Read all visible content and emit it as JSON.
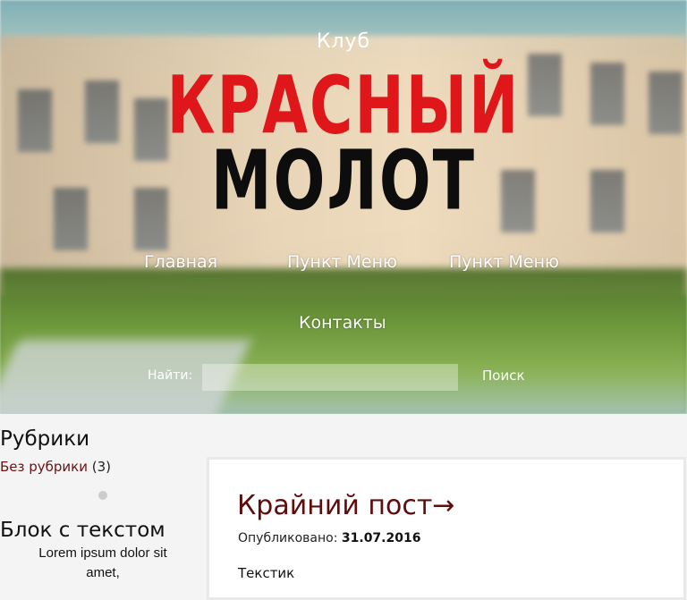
{
  "header": {
    "club": "Клуб",
    "logo_line1": "КРАСНЫЙ",
    "logo_line2": "МОЛОТ"
  },
  "nav": {
    "items": [
      "Главная",
      "Пункт Меню",
      "Пункт Меню",
      "Контакты"
    ]
  },
  "search": {
    "label": "Найти:",
    "value": "",
    "placeholder": "",
    "button": "Поиск"
  },
  "sidebar": {
    "categories_title": "Рубрики",
    "category_name": "Без рубрики",
    "category_count": "(3)",
    "text_block_title": "Блок с текстом",
    "text_block_body": "Lorem ipsum dolor sit amet,"
  },
  "post": {
    "title": "Крайний пост→",
    "published_label": "Опубликовано:",
    "published_date": "31.07.2016",
    "body": "Текстик"
  },
  "colors": {
    "logo_red": "#e0171a",
    "logo_black": "#0d0d0d",
    "post_title": "#5e0c0c",
    "category_link": "#6b1212"
  }
}
